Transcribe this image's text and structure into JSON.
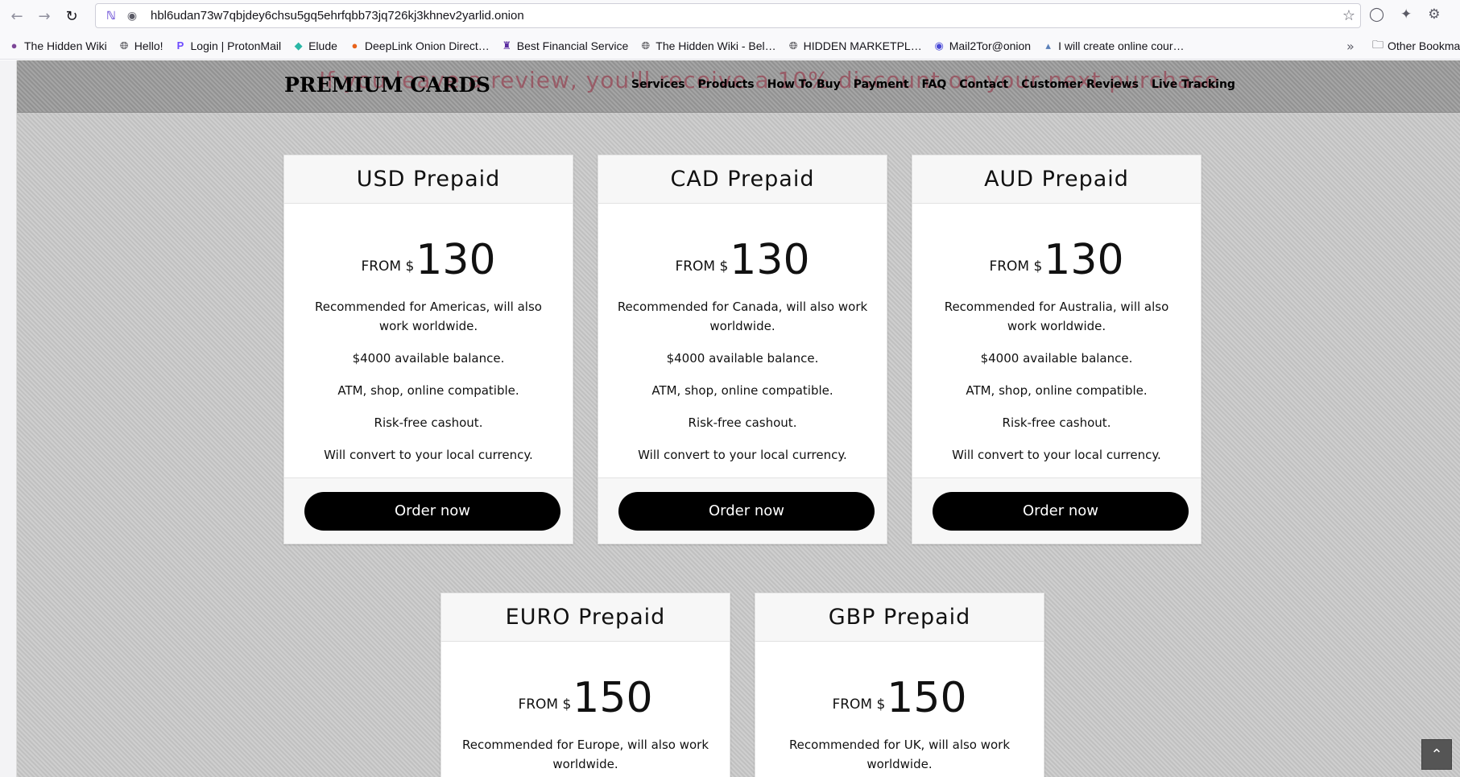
{
  "browser": {
    "url": "hbl6udan73w7qbjdey6chsu5gq5ehrfqbb73jq726kj3khnev2yarlid.onion",
    "bookmarks": [
      {
        "label": "The Hidden Wiki",
        "icon": "onion-icon"
      },
      {
        "label": "Hello!",
        "icon": "globe-icon"
      },
      {
        "label": "Login | ProtonMail",
        "icon": "proton-icon"
      },
      {
        "label": "Elude",
        "icon": "elude-icon"
      },
      {
        "label": "DeepLink Onion Direct…",
        "icon": "deeplink-icon"
      },
      {
        "label": "Best Financial Service",
        "icon": "crown-icon"
      },
      {
        "label": "The Hidden Wiki - Bel…",
        "icon": "globe-icon"
      },
      {
        "label": "HIDDEN MARKETPL…",
        "icon": "globe-icon"
      },
      {
        "label": "Mail2Tor@onion",
        "icon": "mail2tor-icon"
      },
      {
        "label": "I will create online cour…",
        "icon": "network-icon"
      }
    ],
    "other_bookmarks": "Other Bookmarks"
  },
  "site": {
    "marquee": "If you leave a review, you'll receive a 10% discount on your next purchase",
    "logo": "PREMIUM CARDS",
    "nav": [
      "Services",
      "Products",
      "How To Buy",
      "Payment",
      "FAQ",
      "Contact",
      "Customer Reviews",
      "Live Tracking"
    ]
  },
  "cards": [
    {
      "title": "USD Prepaid",
      "from": "FROM $",
      "amount": "130",
      "features": [
        "Recommended for Americas, will also work worldwide.",
        "$4000 available balance.",
        "ATM, shop, online compatible.",
        "Risk-free cashout.",
        "Will convert to your local currency."
      ],
      "button": "Order now"
    },
    {
      "title": "CAD Prepaid",
      "from": "FROM $",
      "amount": "130",
      "features": [
        "Recommended for Canada, will also work worldwide.",
        "$4000 available balance.",
        "ATM, shop, online compatible.",
        "Risk-free cashout.",
        "Will convert to your local currency."
      ],
      "button": "Order now"
    },
    {
      "title": "AUD Prepaid",
      "from": "FROM $",
      "amount": "130",
      "features": [
        "Recommended for Australia, will also work worldwide.",
        "$4000 available balance.",
        "ATM, shop, online compatible.",
        "Risk-free cashout.",
        "Will convert to your local currency."
      ],
      "button": "Order now"
    },
    {
      "title": "EURO Prepaid",
      "from": "FROM $",
      "amount": "150",
      "features": [
        "Recommended for Europe, will also work worldwide."
      ],
      "button": ""
    },
    {
      "title": "GBP Prepaid",
      "from": "FROM $",
      "amount": "150",
      "features": [
        "Recommended for UK, will also work worldwide."
      ],
      "button": ""
    }
  ]
}
